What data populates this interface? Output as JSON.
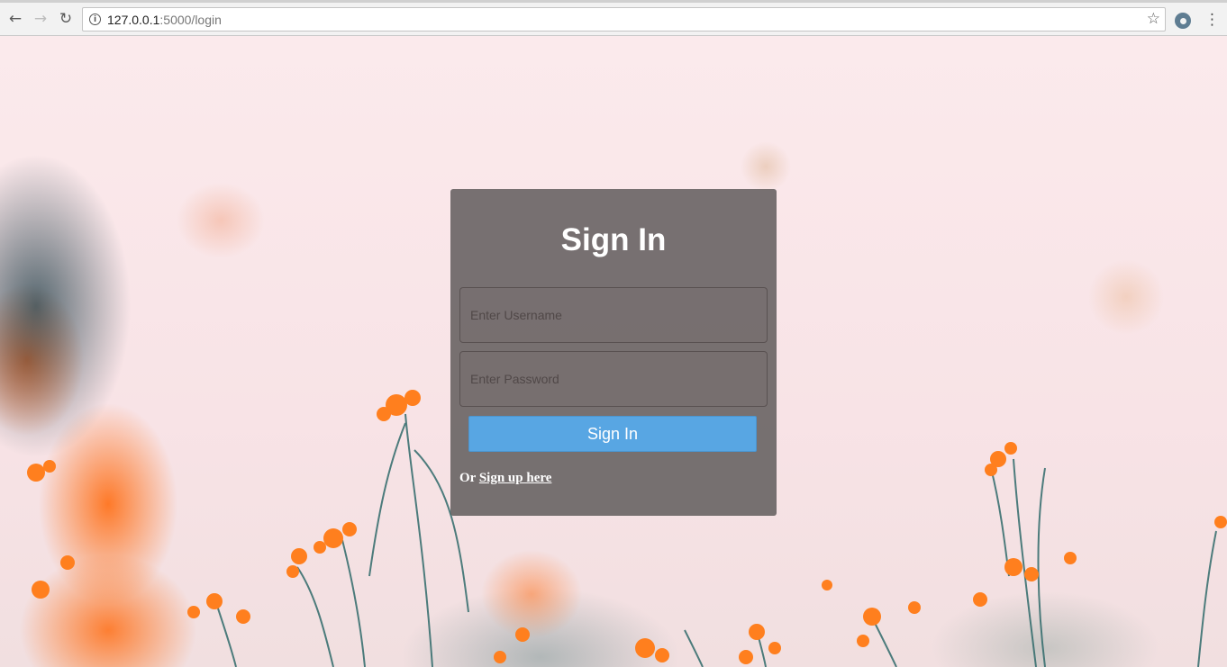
{
  "browser": {
    "url_host": "127.0.0.1",
    "url_path": ":5000/login",
    "icons": {
      "back": "back-arrow-icon",
      "forward": "forward-arrow-icon",
      "reload": "reload-icon",
      "info": "info-icon",
      "bookmark": "star-icon",
      "extension": "extension-eye-icon",
      "menu": "vertical-dots-menu-icon"
    }
  },
  "login": {
    "title": "Sign In",
    "username_placeholder": "Enter Username",
    "password_placeholder": "Enter Password",
    "submit_label": "Sign In",
    "signup_prefix": "Or ",
    "signup_link": "Sign up here"
  },
  "colors": {
    "card_background": "#646060",
    "button": "#58a6e3",
    "text": "#ffffff",
    "flower_accent": "#ff7a1a"
  }
}
